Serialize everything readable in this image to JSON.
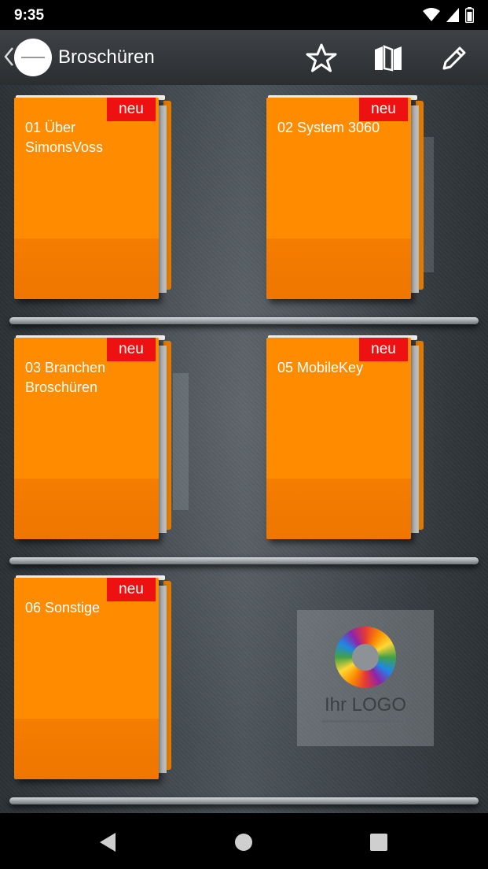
{
  "status_bar": {
    "time": "9:35",
    "icons": [
      "wifi-icon",
      "signal-icon",
      "battery-icon"
    ]
  },
  "app_bar": {
    "title": "Broschüren",
    "actions": [
      "star-icon",
      "map-icon",
      "edit-icon"
    ]
  },
  "folders": [
    {
      "label": "01 Über SimonsVoss",
      "badge": "neu"
    },
    {
      "label": "02 System 3060",
      "badge": "neu"
    },
    {
      "label": "03 Branchen Broschüren",
      "badge": "neu"
    },
    {
      "label": "05 MobileKey",
      "badge": "neu"
    },
    {
      "label": "06 Sonstige",
      "badge": "neu"
    }
  ],
  "logo_placeholder": {
    "text": "Ihr LOGO"
  },
  "nav_bar": {
    "buttons": [
      "back-icon",
      "home-icon",
      "recents-icon"
    ]
  },
  "colors": {
    "folder": "#ff8c00",
    "badge": "#ee1111",
    "app_bar": "#3a3e42"
  }
}
